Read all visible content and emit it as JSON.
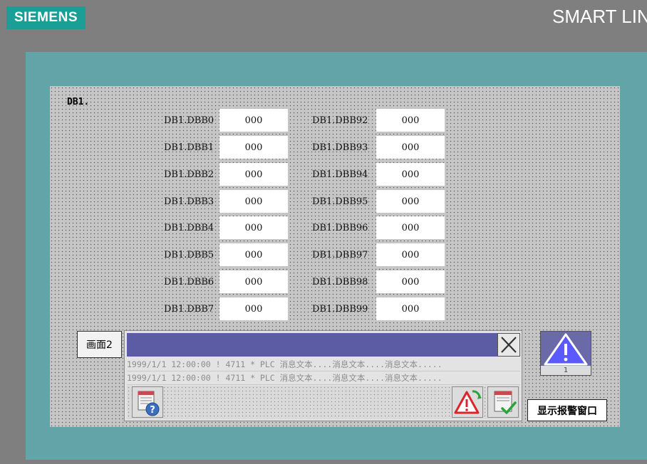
{
  "header": {
    "logo_text": "SIEMENS",
    "title": "SMART LIN"
  },
  "screen": {
    "title": "DB1.",
    "left_column": [
      {
        "label": "DB1.DBB0",
        "value": "000"
      },
      {
        "label": "DB1.DBB1",
        "value": "000"
      },
      {
        "label": "DB1.DBB2",
        "value": "000"
      },
      {
        "label": "DB1.DBB3",
        "value": "000"
      },
      {
        "label": "DB1.DBB4",
        "value": "000"
      },
      {
        "label": "DB1.DBB5",
        "value": "000"
      },
      {
        "label": "DB1.DBB6",
        "value": "000"
      },
      {
        "label": "DB1.DBB7",
        "value": "000"
      }
    ],
    "right_column": [
      {
        "label": "DB1.DBB92",
        "value": "000"
      },
      {
        "label": "DB1.DBB93",
        "value": "000"
      },
      {
        "label": "DB1.DBB94",
        "value": "000"
      },
      {
        "label": "DB1.DBB95",
        "value": "000"
      },
      {
        "label": "DB1.DBB96",
        "value": "000"
      },
      {
        "label": "DB1.DBB97",
        "value": "000"
      },
      {
        "label": "DB1.DBB98",
        "value": "000"
      },
      {
        "label": "DB1.DBB99",
        "value": "000"
      }
    ]
  },
  "navigation": {
    "screen2_button": "画面2"
  },
  "alarm_window": {
    "rows": [
      "1999/1/1 12:00:00 ! 4711 * PLC 消息文本....消息文本....消息文本.....",
      "1999/1/1 12:00:00 ! 4711 * PLC 消息文本....消息文本....消息文本....."
    ]
  },
  "alarm_indicator": {
    "count": "1"
  },
  "show_alarm_button": "显示报警窗口",
  "colors": {
    "background": "#7f7f7f",
    "frame": "#63a4a9",
    "screen": "#c6c6c6",
    "siemens_teal": "#1b9e95",
    "alarm_titlebar": "#5c5ca5",
    "warning_red": "#d9262c",
    "ack_green": "#2aa33a"
  },
  "icons": {
    "close": "close-x-icon",
    "help": "help-question-icon",
    "loop_in_alarm": "warning-refresh-icon",
    "acknowledge": "acknowledge-check-icon",
    "alarm_indicator": "warning-triangle-icon"
  }
}
